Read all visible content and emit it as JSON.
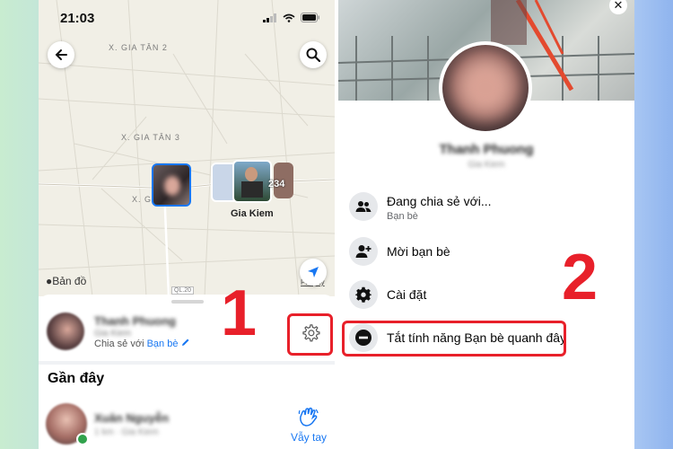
{
  "left": {
    "status": {
      "time": "21:03"
    },
    "map": {
      "labels": [
        "X. GIA TÂN 2",
        "X. GIA TÂN 3",
        "X. G",
        "Gia Kiem",
        "QL.20"
      ],
      "stack_count": "234",
      "apple_maps": "Bản đồ",
      "legal": "Pháp lý"
    },
    "sheet": {
      "friend_name": "Thanh Phuong",
      "friend_loc": "Gia Kiem",
      "sharing_prefix": "Chia sẻ với ",
      "sharing_link": "Bạn bè",
      "recent_title": "Gần đây",
      "recent_name": "Xuân Nguyễn",
      "recent_sub": "1 km · Gia Kiem",
      "wave_label": "Vẫy tay"
    },
    "annotation": "1"
  },
  "right": {
    "profile_name": "Thanh Phuong",
    "profile_sub": "Gia Kiem",
    "menu": [
      {
        "label": "Đang chia sẻ với...",
        "sub": "Bạn bè"
      },
      {
        "label": "Mời bạn bè",
        "sub": ""
      },
      {
        "label": "Cài đặt",
        "sub": ""
      },
      {
        "label": "Tắt tính năng Bạn bè quanh đây",
        "sub": ""
      }
    ],
    "annotation": "2"
  },
  "colors": {
    "accent": "#1877f2",
    "highlight": "#e8202a"
  }
}
